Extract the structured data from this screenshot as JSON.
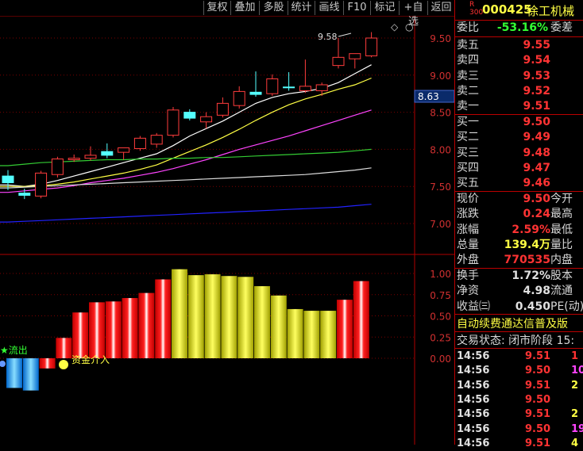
{
  "toolbar": {
    "buttons": [
      "复权",
      "叠加",
      "多股",
      "统计",
      "画线",
      "F10",
      "标记",
      "+自选",
      "返回"
    ]
  },
  "chart": {
    "diamond_icon": "◇",
    "ellipsis": "○",
    "peak_label": "9.58",
    "price_axis": [
      "9.50",
      "9.00",
      "8.50",
      "8.00",
      "7.50",
      "7.00"
    ],
    "price_marker": "8.63",
    "indicator_axis": [
      "1.00",
      "0.75",
      "0.50",
      "0.25",
      "0.00"
    ],
    "outflow_label": "★流出",
    "inflow_label": "资金介入"
  },
  "chart_data": {
    "type": "candlestick",
    "ylim": [
      6.8,
      9.75
    ],
    "candles": [
      {
        "o": 7.64,
        "h": 7.72,
        "l": 7.45,
        "c": 7.55,
        "up": false
      },
      {
        "o": 7.41,
        "h": 7.47,
        "l": 7.33,
        "c": 7.38,
        "up": false
      },
      {
        "o": 7.37,
        "h": 7.71,
        "l": 7.34,
        "c": 7.68,
        "up": true
      },
      {
        "o": 7.66,
        "h": 7.9,
        "l": 7.62,
        "c": 7.87,
        "up": true
      },
      {
        "o": 7.88,
        "h": 7.93,
        "l": 7.83,
        "c": 7.86,
        "up": true
      },
      {
        "o": 7.88,
        "h": 8.04,
        "l": 7.85,
        "c": 7.92,
        "up": true
      },
      {
        "o": 7.92,
        "h": 8.08,
        "l": 7.88,
        "c": 7.97,
        "up": false
      },
      {
        "o": 7.96,
        "h": 8.02,
        "l": 7.86,
        "c": 8.02,
        "up": true
      },
      {
        "o": 8.01,
        "h": 8.18,
        "l": 7.98,
        "c": 8.15,
        "up": true
      },
      {
        "o": 8.07,
        "h": 8.22,
        "l": 8.02,
        "c": 8.19,
        "up": true
      },
      {
        "o": 8.19,
        "h": 8.57,
        "l": 8.16,
        "c": 8.53,
        "up": true
      },
      {
        "o": 8.5,
        "h": 8.54,
        "l": 8.39,
        "c": 8.42,
        "up": false
      },
      {
        "o": 8.37,
        "h": 8.5,
        "l": 8.28,
        "c": 8.44,
        "up": true
      },
      {
        "o": 8.46,
        "h": 8.7,
        "l": 8.43,
        "c": 8.62,
        "up": true
      },
      {
        "o": 8.59,
        "h": 8.85,
        "l": 8.55,
        "c": 8.78,
        "up": true
      },
      {
        "o": 8.77,
        "h": 9.05,
        "l": 8.71,
        "c": 8.74,
        "up": false
      },
      {
        "o": 8.75,
        "h": 9.01,
        "l": 8.72,
        "c": 8.95,
        "up": true
      },
      {
        "o": 8.84,
        "h": 9.04,
        "l": 8.79,
        "c": 8.83,
        "up": false
      },
      {
        "o": 8.79,
        "h": 9.21,
        "l": 8.76,
        "c": 8.85,
        "up": true
      },
      {
        "o": 8.79,
        "h": 8.9,
        "l": 8.72,
        "c": 8.87,
        "up": true
      },
      {
        "o": 9.13,
        "h": 9.5,
        "l": 9.09,
        "c": 9.24,
        "up": true
      },
      {
        "o": 9.22,
        "h": 9.29,
        "l": 9.09,
        "c": 9.29,
        "up": true
      },
      {
        "o": 9.26,
        "h": 9.58,
        "l": 9.24,
        "c": 9.5,
        "up": true
      }
    ],
    "ma_lines": [
      {
        "color": "#ffffff",
        "values": [
          7.52,
          7.5,
          7.53,
          7.58,
          7.64,
          7.7,
          7.76,
          7.82,
          7.88,
          7.94,
          8.05,
          8.18,
          8.28,
          8.38,
          8.5,
          8.62,
          8.7,
          8.75,
          8.78,
          8.82,
          8.9,
          9.02,
          9.14
        ]
      },
      {
        "color": "#ffff44",
        "values": [
          7.5,
          7.5,
          7.51,
          7.53,
          7.56,
          7.6,
          7.64,
          7.68,
          7.73,
          7.79,
          7.88,
          7.97,
          8.06,
          8.16,
          8.27,
          8.39,
          8.5,
          8.6,
          8.68,
          8.74,
          8.81,
          8.87,
          8.96
        ]
      },
      {
        "color": "#ff44ff",
        "values": [
          7.42,
          7.44,
          7.46,
          7.48,
          7.51,
          7.55,
          7.58,
          7.61,
          7.65,
          7.69,
          7.74,
          7.8,
          7.86,
          7.93,
          8.0,
          8.06,
          8.12,
          8.18,
          8.25,
          8.32,
          8.39,
          8.46,
          8.53
        ]
      },
      {
        "color": "#33cc33",
        "values": [
          7.78,
          7.8,
          7.82,
          7.83,
          7.84,
          7.85,
          7.86,
          7.86,
          7.87,
          7.87,
          7.88,
          7.88,
          7.89,
          7.89,
          7.9,
          7.91,
          7.92,
          7.93,
          7.94,
          7.95,
          7.96,
          7.98,
          8.0
        ]
      },
      {
        "color": "#dddddd",
        "values": [
          7.48,
          7.49,
          7.5,
          7.51,
          7.52,
          7.53,
          7.54,
          7.55,
          7.56,
          7.57,
          7.58,
          7.59,
          7.6,
          7.61,
          7.62,
          7.63,
          7.64,
          7.65,
          7.66,
          7.68,
          7.7,
          7.72,
          7.75
        ]
      },
      {
        "color": "#2222ff",
        "values": [
          7.02,
          7.03,
          7.04,
          7.05,
          7.06,
          7.07,
          7.08,
          7.09,
          7.1,
          7.11,
          7.12,
          7.13,
          7.14,
          7.15,
          7.16,
          7.17,
          7.18,
          7.19,
          7.2,
          7.21,
          7.22,
          7.24,
          7.26
        ]
      }
    ],
    "indicator": {
      "ylim": [
        -0.4,
        1.08
      ],
      "bars": [
        {
          "v": -0.35,
          "c": "blue"
        },
        {
          "v": -0.38,
          "c": "blue"
        },
        {
          "v": -0.12,
          "c": "red"
        },
        {
          "v": 0.24,
          "c": "red"
        },
        {
          "v": 0.54,
          "c": "red"
        },
        {
          "v": 0.66,
          "c": "red"
        },
        {
          "v": 0.67,
          "c": "red"
        },
        {
          "v": 0.71,
          "c": "red"
        },
        {
          "v": 0.77,
          "c": "red"
        },
        {
          "v": 0.93,
          "c": "red"
        },
        {
          "v": 1.05,
          "c": "yellow"
        },
        {
          "v": 0.98,
          "c": "yellow"
        },
        {
          "v": 0.99,
          "c": "yellow"
        },
        {
          "v": 0.97,
          "c": "yellow"
        },
        {
          "v": 0.96,
          "c": "yellow"
        },
        {
          "v": 0.85,
          "c": "yellow"
        },
        {
          "v": 0.74,
          "c": "yellow"
        },
        {
          "v": 0.58,
          "c": "yellow"
        },
        {
          "v": 0.56,
          "c": "yellow"
        },
        {
          "v": 0.56,
          "c": "yellow"
        },
        {
          "v": 0.69,
          "c": "red"
        },
        {
          "v": 0.91,
          "c": "red"
        }
      ]
    }
  },
  "stock": {
    "badge_top": "R",
    "badge_bottom": "300",
    "code": "000425",
    "name": "徐工机械"
  },
  "order_book": {
    "ratio_label": "委比",
    "ratio_value": "-53.16%",
    "diff_label": "委差",
    "sells": [
      {
        "label": "卖五",
        "price": "9.55"
      },
      {
        "label": "卖四",
        "price": "9.54"
      },
      {
        "label": "卖三",
        "price": "9.53"
      },
      {
        "label": "卖二",
        "price": "9.52"
      },
      {
        "label": "卖一",
        "price": "9.51"
      }
    ],
    "buys": [
      {
        "label": "买一",
        "price": "9.50"
      },
      {
        "label": "买二",
        "price": "9.49"
      },
      {
        "label": "买三",
        "price": "9.48"
      },
      {
        "label": "买四",
        "price": "9.47"
      },
      {
        "label": "买五",
        "price": "9.46"
      }
    ]
  },
  "quote": [
    {
      "label": "现价",
      "value": "9.50",
      "color": "#ff3333",
      "label2": "今开"
    },
    {
      "label": "涨跌",
      "value": "0.24",
      "color": "#ff3333",
      "label2": "最高"
    },
    {
      "label": "涨幅",
      "value": "2.59%",
      "color": "#ff3333",
      "label2": "最低"
    },
    {
      "label": "总量",
      "value": "139.4万",
      "color": "#ffff44",
      "label2": "量比"
    },
    {
      "label": "外盘",
      "value": "770535",
      "color": "#ff3333",
      "label2": "内盘"
    }
  ],
  "stats": [
    {
      "label": "换手",
      "value": "1.72%",
      "label2": "股本"
    },
    {
      "label": "净资",
      "value": "4.98",
      "label2": "流通"
    },
    {
      "label": "收益㈢",
      "value": "0.450",
      "label2": "PE(动)"
    }
  ],
  "banner": "自动续费通达信普及版",
  "trade_state": "交易状态: 闭市阶段 15:",
  "ticks": [
    {
      "time": "14:56",
      "price": "9.51",
      "pc": "#ff3333",
      "vol": "1",
      "vc": "#ff3333"
    },
    {
      "time": "14:56",
      "price": "9.50",
      "pc": "#ff3333",
      "vol": "10",
      "vc": "#ff44ff"
    },
    {
      "time": "14:56",
      "price": "9.51",
      "pc": "#ff3333",
      "vol": "2",
      "vc": "#ffff44"
    },
    {
      "time": "14:56",
      "price": "9.50",
      "pc": "#ff3333",
      "vol": "",
      "vc": "#ffffff"
    },
    {
      "time": "14:56",
      "price": "9.51",
      "pc": "#ff3333",
      "vol": "2",
      "vc": "#ffff44"
    },
    {
      "time": "14:56",
      "price": "9.50",
      "pc": "#ff3333",
      "vol": "19",
      "vc": "#ff44ff"
    },
    {
      "time": "14:56",
      "price": "9.51",
      "pc": "#ff3333",
      "vol": "4",
      "vc": "#ffff44"
    }
  ]
}
